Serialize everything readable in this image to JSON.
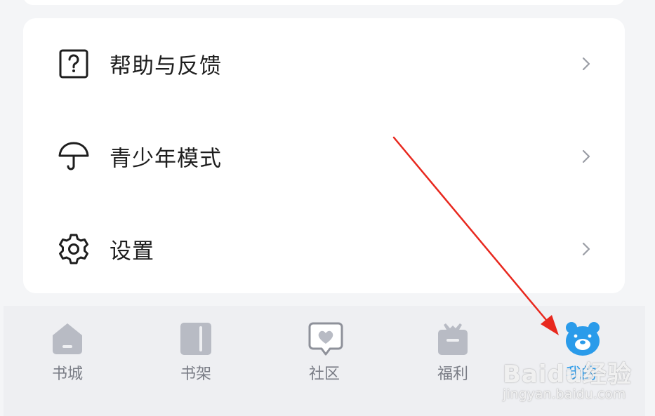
{
  "menu": {
    "items": [
      {
        "label": "帮助与反馈",
        "icon": "help-question-icon"
      },
      {
        "label": "青少年模式",
        "icon": "umbrella-icon"
      },
      {
        "label": "设置",
        "icon": "gear-icon"
      }
    ]
  },
  "tabbar": {
    "tabs": [
      {
        "label": "书城",
        "icon": "bookstore-house-icon"
      },
      {
        "label": "书架",
        "icon": "bookshelf-book-icon"
      },
      {
        "label": "社区",
        "icon": "community-heart-chat-icon"
      },
      {
        "label": "福利",
        "icon": "welfare-gift-icon"
      },
      {
        "label": "我的",
        "icon": "bear-profile-icon",
        "active": true
      }
    ],
    "inactive_color": "#b8bbc4",
    "active_color": "#2a9bea"
  },
  "watermark": {
    "brand": "Baidu经验",
    "url": "jingyan.baidu.com"
  },
  "annotation": {
    "arrow_color": "#e8281e"
  }
}
